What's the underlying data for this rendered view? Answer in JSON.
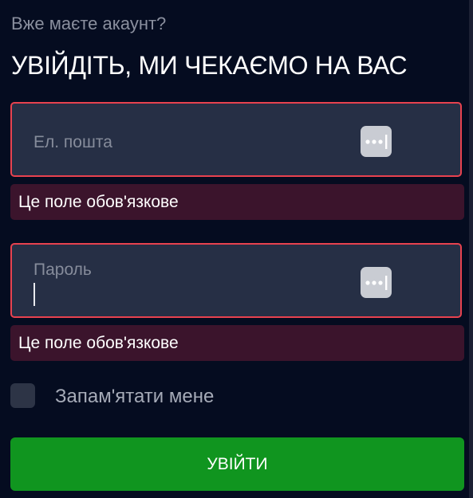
{
  "header": {
    "subtitle": "Вже маєте акаунт?",
    "title": "УВІЙДІТЬ, МИ ЧЕКАЄМО НА ВАС"
  },
  "form": {
    "email": {
      "label": "Ел. пошта",
      "value": "",
      "error": "Це поле обов'язкове",
      "icon": "password-manager-icon"
    },
    "password": {
      "label": "Пароль",
      "value": "",
      "error": "Це поле обов'язкове",
      "icon": "password-manager-icon"
    },
    "remember": {
      "label": "Запам'ятати мене",
      "checked": false
    },
    "submit_label": "УВІЙТИ"
  },
  "colors": {
    "background": "#050c20",
    "field_background": "#262f45",
    "error_border": "#e8424f",
    "error_background": "#3b142c",
    "button": "#10951f",
    "text_muted": "#8a8f9e"
  }
}
